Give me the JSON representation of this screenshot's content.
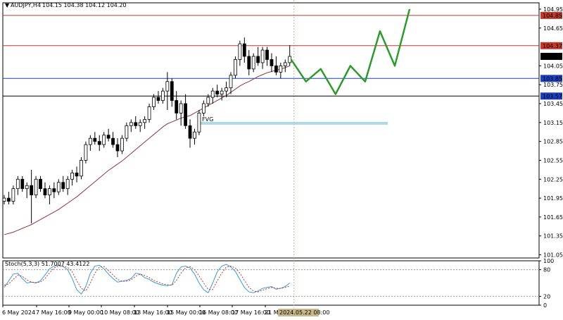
{
  "header": {
    "arrow": "▼",
    "symbol": "AUDJPY,H4",
    "ohlc": "104.15 104.38 104.12 104.20"
  },
  "stoch_header": "Stoch(5,3,3) 51.7007 43.4122",
  "fvg_label": "FVG",
  "colors": {
    "up_candle": "#ffffff",
    "down_candle": "#000000",
    "ma": "#8b3a3a",
    "red_level": "#c0392b",
    "blue_level": "#1f3fbf",
    "black_level": "#000000",
    "fvg_zone": "#add8e6",
    "forecast": "#2e9a2e",
    "stoch_main": "#3a9ad9",
    "stoch_signal": "#c0392b",
    "dotted_vertical": "#c8b88a"
  },
  "price_axis": {
    "ticks": [
      "104.95",
      "104.65",
      "104.05",
      "103.75",
      "103.45",
      "103.15",
      "102.85",
      "102.55",
      "102.25",
      "101.95",
      "101.65",
      "101.35",
      "101.05"
    ],
    "labels": [
      {
        "text": "104.85",
        "bg": "#c0392b",
        "fg": "#ffffff"
      },
      {
        "text": "104.37",
        "bg": "#c0392b",
        "fg": "#ffffff"
      },
      {
        "text": "104.20",
        "bg": "#000000",
        "fg": "#ffffff"
      },
      {
        "text": "103.85",
        "bg": "#1f3fbf",
        "fg": "#ffffff"
      },
      {
        "text": "103.57",
        "bg": "#1f3fbf",
        "fg": "#ffffff"
      }
    ]
  },
  "stoch_axis": {
    "ticks": [
      "100",
      "80",
      "20",
      "0"
    ]
  },
  "time_axis": {
    "labels": [
      "6 May 2024",
      "7 May 16:00",
      "9 May 00:00",
      "10 May 08:00",
      "13 May 16:00",
      "15 May 00:00",
      "16 May 08:00",
      "17 May 16:00",
      "21 Ma"
    ],
    "highlight": "2024.05.22 08:00"
  },
  "chart_data": {
    "type": "candlestick",
    "title": "AUDJPY,H4",
    "ylim": [
      101.0,
      105.05
    ],
    "candles": [
      [
        101.9,
        102.0,
        101.85,
        101.95
      ],
      [
        101.95,
        102.05,
        101.85,
        101.9
      ],
      [
        101.9,
        102.15,
        101.85,
        102.1
      ],
      [
        102.1,
        102.3,
        102.0,
        102.25
      ],
      [
        102.25,
        102.3,
        102.05,
        102.1
      ],
      [
        102.1,
        102.2,
        101.95,
        102.15
      ],
      [
        102.15,
        102.4,
        101.55,
        102.0
      ],
      [
        102.0,
        102.3,
        101.95,
        102.25
      ],
      [
        102.25,
        102.3,
        102.05,
        102.1
      ],
      [
        102.1,
        102.2,
        101.95,
        102.0
      ],
      [
        102.0,
        102.15,
        101.85,
        102.1
      ],
      [
        102.1,
        102.2,
        101.95,
        102.05
      ],
      [
        102.05,
        102.25,
        102.0,
        102.2
      ],
      [
        102.2,
        102.3,
        102.05,
        102.1
      ],
      [
        102.1,
        102.3,
        102.0,
        102.25
      ],
      [
        102.25,
        102.4,
        102.15,
        102.35
      ],
      [
        102.35,
        102.45,
        102.2,
        102.3
      ],
      [
        102.3,
        102.6,
        102.25,
        102.55
      ],
      [
        102.55,
        102.85,
        102.5,
        102.8
      ],
      [
        102.8,
        102.95,
        102.7,
        102.9
      ],
      [
        102.9,
        103.0,
        102.8,
        102.85
      ],
      [
        102.85,
        102.95,
        102.7,
        102.8
      ],
      [
        102.8,
        103.0,
        102.75,
        102.95
      ],
      [
        102.95,
        103.05,
        102.85,
        102.9
      ],
      [
        102.9,
        103.0,
        102.75,
        102.8
      ],
      [
        102.8,
        102.9,
        102.6,
        102.7
      ],
      [
        102.7,
        102.95,
        102.65,
        102.9
      ],
      [
        102.9,
        103.15,
        102.85,
        103.1
      ],
      [
        103.1,
        103.2,
        103.0,
        103.15
      ],
      [
        103.15,
        103.25,
        103.05,
        103.1
      ],
      [
        103.1,
        103.2,
        103.0,
        103.15
      ],
      [
        103.15,
        103.25,
        103.05,
        103.2
      ],
      [
        103.2,
        103.45,
        103.15,
        103.4
      ],
      [
        103.4,
        103.6,
        103.35,
        103.55
      ],
      [
        103.55,
        103.65,
        103.45,
        103.5
      ],
      [
        103.5,
        103.7,
        103.45,
        103.65
      ],
      [
        103.65,
        103.95,
        103.35,
        103.8
      ],
      [
        103.8,
        103.85,
        103.4,
        103.5
      ],
      [
        103.5,
        103.65,
        103.2,
        103.3
      ],
      [
        103.3,
        103.5,
        103.1,
        103.45
      ],
      [
        103.45,
        103.6,
        103.05,
        103.1
      ],
      [
        103.1,
        103.2,
        102.75,
        102.9
      ],
      [
        102.9,
        103.05,
        102.8,
        103.0
      ],
      [
        103.0,
        103.35,
        102.95,
        103.3
      ],
      [
        103.3,
        103.5,
        103.25,
        103.45
      ],
      [
        103.45,
        103.6,
        103.4,
        103.55
      ],
      [
        103.55,
        103.7,
        103.45,
        103.65
      ],
      [
        103.65,
        103.75,
        103.55,
        103.6
      ],
      [
        103.6,
        103.7,
        103.5,
        103.65
      ],
      [
        103.65,
        103.8,
        103.55,
        103.7
      ],
      [
        103.7,
        103.95,
        103.6,
        103.9
      ],
      [
        103.9,
        104.2,
        103.85,
        104.15
      ],
      [
        104.15,
        104.45,
        104.05,
        104.4
      ],
      [
        104.4,
        104.5,
        104.1,
        104.2
      ],
      [
        104.2,
        104.3,
        103.9,
        104.0
      ],
      [
        104.0,
        104.25,
        103.95,
        104.2
      ],
      [
        104.2,
        104.35,
        104.05,
        104.1
      ],
      [
        104.1,
        104.35,
        104.0,
        104.3
      ],
      [
        104.3,
        104.35,
        104.05,
        104.15
      ],
      [
        104.15,
        104.25,
        103.95,
        104.05
      ],
      [
        104.05,
        104.2,
        103.9,
        103.95
      ],
      [
        103.95,
        104.1,
        103.85,
        104.05
      ],
      [
        104.05,
        104.15,
        103.95,
        104.1
      ],
      [
        104.1,
        104.38,
        104.05,
        104.2
      ]
    ],
    "ma": [
      101.37,
      101.39,
      101.41,
      101.44,
      101.47,
      101.5,
      101.53,
      101.57,
      101.61,
      101.65,
      101.69,
      101.73,
      101.77,
      101.82,
      101.87,
      101.92,
      101.97,
      102.03,
      102.09,
      102.15,
      102.21,
      102.27,
      102.33,
      102.39,
      102.44,
      102.49,
      102.54,
      102.6,
      102.66,
      102.72,
      102.78,
      102.84,
      102.9,
      102.96,
      103.02,
      103.08,
      103.13,
      103.16,
      103.19,
      103.22,
      103.24,
      103.26,
      103.3,
      103.34,
      103.38,
      103.42,
      103.46,
      103.5,
      103.54,
      103.58,
      103.63,
      103.68,
      103.73,
      103.77,
      103.8,
      103.84,
      103.88,
      103.91,
      103.94,
      103.96,
      103.98,
      104.0,
      104.02,
      104.05
    ],
    "levels": [
      104.85,
      104.37,
      103.85,
      103.57
    ],
    "fvg": {
      "low": 103.12,
      "high": 103.16
    },
    "forecast_path": [
      104.15,
      103.8,
      104.0,
      103.6,
      104.05,
      103.8,
      104.6,
      104.05,
      104.95
    ],
    "stochastic": {
      "main": [
        40,
        55,
        70,
        72,
        60,
        50,
        52,
        50,
        55,
        68,
        82,
        88,
        90,
        87,
        80,
        60,
        35,
        25,
        42,
        72,
        88,
        90,
        82,
        70,
        60,
        52,
        54,
        56,
        60,
        72,
        70,
        62,
        58,
        52,
        48,
        45,
        44,
        46,
        72,
        86,
        88,
        84,
        70,
        50,
        35,
        28,
        50,
        75,
        88,
        92,
        86,
        76,
        58,
        40,
        30,
        28,
        32,
        38,
        40,
        42,
        36,
        38,
        42,
        50
      ],
      "signal": [
        45,
        48,
        58,
        68,
        65,
        57,
        52,
        51,
        52,
        60,
        73,
        84,
        88,
        88,
        85,
        75,
        55,
        38,
        32,
        50,
        72,
        86,
        87,
        78,
        68,
        58,
        54,
        54,
        57,
        65,
        70,
        67,
        62,
        56,
        52,
        48,
        46,
        45,
        56,
        72,
        84,
        87,
        80,
        66,
        50,
        36,
        35,
        55,
        72,
        86,
        88,
        84,
        72,
        56,
        40,
        32,
        30,
        34,
        37,
        40,
        38,
        38,
        40,
        43
      ],
      "ylim": [
        0,
        100
      ],
      "levels": [
        80,
        20
      ]
    }
  }
}
